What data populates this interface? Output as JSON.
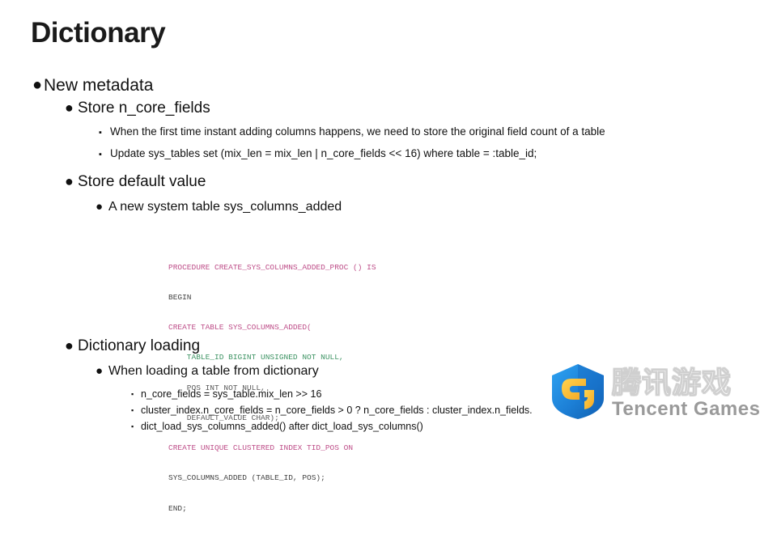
{
  "slide": {
    "title": "Dictionary",
    "bullets": {
      "new_metadata": "New metadata",
      "store_n_core_fields": "Store n_core_fields",
      "when_first_time": "When the first time instant adding columns  happens,  we need to store the original field count of a table",
      "update_sys_tables": "Update sys_tables set (mix_len = mix_len | n_core_fields << 16) where table = :table_id;",
      "store_default_value": "Store default value",
      "a_new_system_table": "A new system table sys_columns_added",
      "dictionary_loading": "Dictionary loading",
      "when_loading_table": "When loading a table from dictionary",
      "n_core_fields_expr": "n_core_fields = sys_table.mix_len >> 16",
      "cluster_index_expr": "cluster_index.n_core_fields = n_core_fields > 0 ? n_core_fields : cluster_index.n_fields.",
      "dict_load_expr": "dict_load_sys_columns_added() after dict_load_sys_columns()"
    },
    "code": [
      "PROCEDURE CREATE_SYS_COLUMNS_ADDED_PROC () IS",
      "BEGIN",
      "CREATE TABLE SYS_COLUMNS_ADDED(",
      "    TABLE_ID BIGINT UNSIGNED NOT NULL,",
      "    POS INT NOT NULL,",
      "    DEFAULT_VALUE CHAR);",
      "CREATE UNIQUE CLUSTERED INDEX TID_POS ON",
      "SYS_COLUMNS_ADDED (TABLE_ID, POS);",
      "END;"
    ],
    "logo": {
      "chinese": "腾讯游戏",
      "english": "Tencent Games"
    },
    "glyphs": {
      "round_bullet": "●",
      "small_bullet": "▪"
    }
  }
}
